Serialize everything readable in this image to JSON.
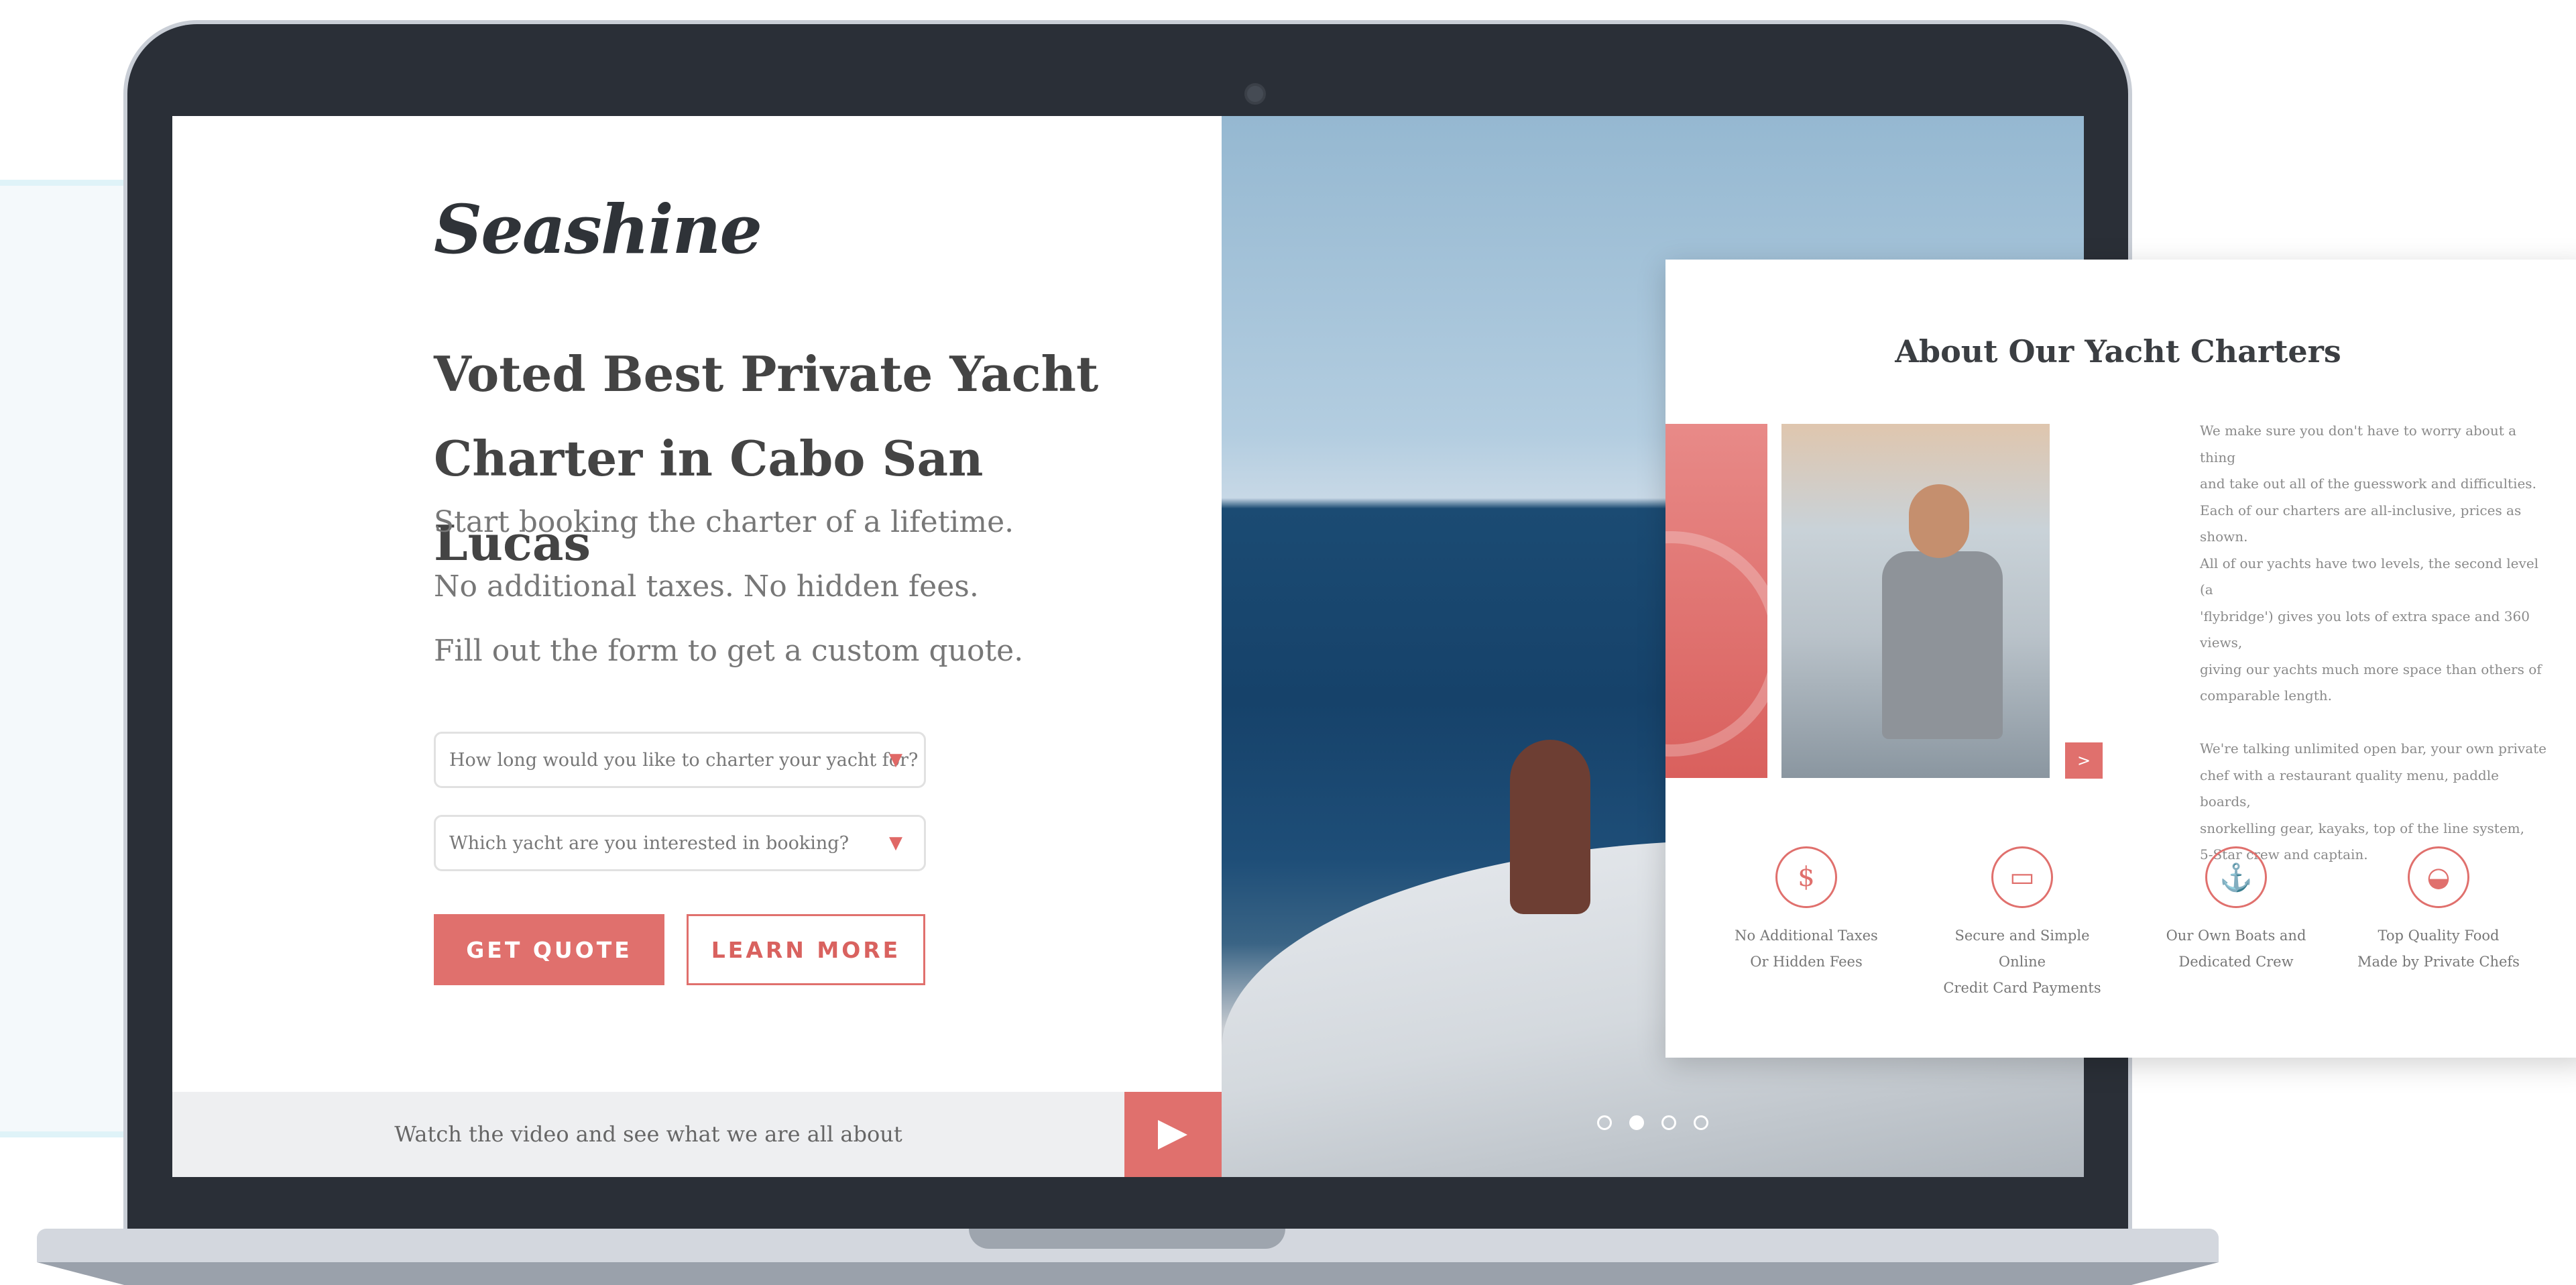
{
  "site": {
    "logo": "Seashine",
    "headline_line1": "Voted Best Private Yacht",
    "headline_line2": "Charter in Cabo San Lucas",
    "subtitles": [
      "Start booking the charter of a lifetime.",
      "No additional taxes. No hidden fees.",
      "Fill out the form to get a custom quote."
    ],
    "select_duration": "How long would you like to charter your yacht for?",
    "select_yacht": "Which yacht are you interested in booking?",
    "select_arrow": "▼",
    "get_quote": "GET QUOTE",
    "learn_more": "LEARN MORE",
    "video_text": "Watch the video and see what we are all about"
  },
  "slider": {
    "dots": 4,
    "active_index": 1
  },
  "about": {
    "title": "About Our Yacht Charters",
    "next": ">",
    "text": "We make sure you don't have to worry about a thing\nand take out all of the guesswork and difficulties.\n Each of our charters are all-inclusive, prices as shown.\nAll of our yachts have two levels, the second level (a\n'flybridge') gives you lots of extra space and 360 views,\ngiving our yachts much more space than others of\ncomparable length.\n\n We're talking unlimited open bar, your own private\nchef with a restaurant quality menu, paddle boards,\nsnorkelling gear, kayaks, top of the line system,\n5-Star crew and captain.",
    "features": [
      {
        "icon": "money-bag-icon",
        "glyph": "$",
        "line1": "No Additional Taxes",
        "line2": "Or Hidden Fees"
      },
      {
        "icon": "credit-card-icon",
        "glyph": "▭",
        "line1": "Secure and Simple Online",
        "line2": "Credit Card Payments"
      },
      {
        "icon": "anchor-icon",
        "glyph": "⚓",
        "line1": "Our Own Boats and",
        "line2": "Dedicated Crew"
      },
      {
        "icon": "cloche-icon",
        "glyph": "◒",
        "line1": "Top Quality Food",
        "line2": "Made by Private Chefs"
      }
    ]
  },
  "colors": {
    "accent": "#e0706d",
    "dark": "#2a2f37"
  }
}
